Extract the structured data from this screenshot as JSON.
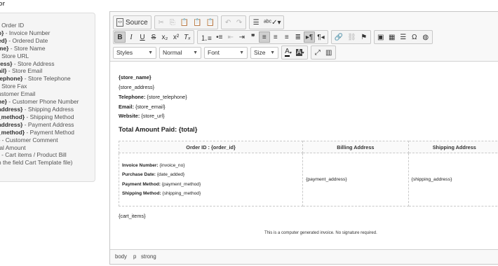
{
  "vars_panel": {
    "title": "or",
    "items": [
      {
        "code": "",
        "desc": "- Order ID"
      },
      {
        "code": "o}",
        "desc": " - Invoice Number"
      },
      {
        "code": "ed}",
        "desc": " - Ordered Date"
      },
      {
        "code": "me}",
        "desc": " - Store Name"
      },
      {
        "code": "",
        "desc": "- Store URL"
      },
      {
        "code": "ress}",
        "desc": " - Store Address"
      },
      {
        "code": "ail}",
        "desc": " - Store Email"
      },
      {
        "code": "lephone}",
        "desc": " - Store Telephone"
      },
      {
        "code": "",
        "desc": "- Store Fax"
      },
      {
        "code": "",
        "desc": "ustomer Email"
      },
      {
        "code": "ne}",
        "desc": " - Customer Phone Number"
      },
      {
        "code": "address}",
        "desc": " - Shipping Address"
      },
      {
        "code": "_method}",
        "desc": " - Shipping Method"
      },
      {
        "code": "address}",
        "desc": " - Payment Address"
      },
      {
        "code": "_method}",
        "desc": " - Payment Method"
      },
      {
        "code": "}",
        "desc": " - Customer Comment"
      },
      {
        "code": "",
        "desc": "tal Amount"
      },
      {
        "code": "",
        "desc": "} - Cart items / Product Bill"
      },
      {
        "code": "",
        "desc": "n the field Cart Template file)"
      }
    ]
  },
  "toolbar": {
    "source_label": "Source",
    "styles": "Styles",
    "format": "Normal",
    "font": "Font",
    "size": "Size"
  },
  "content": {
    "store_name": "{store_name}",
    "store_address": "{store_address}",
    "telephone_label": "Telephone:",
    "telephone_value": "{store_telephone}",
    "email_label": "Email:",
    "email_value": "{store_email}",
    "website_label": "Website:",
    "website_value": "{store_url}",
    "total_label": "Total Amount Paid:",
    "total_value": "{total}",
    "table": {
      "headers": [
        "Order ID : {order_id}",
        "Billing Address",
        "Shipping Address"
      ],
      "invoice_label": "Invoice Number:",
      "invoice_value": "{invoice_no}",
      "purchase_label": "Purchase Date:",
      "purchase_value": "{date_added}",
      "payment_label": "Payment Method:",
      "payment_value": "{payment_method}",
      "shipping_label": "Shipping Method:",
      "shipping_value": "{shipping_method}",
      "billing": "{payment_address}",
      "shipping": "{shipping_address}"
    },
    "cart_items": "{cart_items}",
    "note": "This is a computer generated invoice. No signature required."
  },
  "pathbar": [
    "body",
    "p",
    "strong"
  ]
}
